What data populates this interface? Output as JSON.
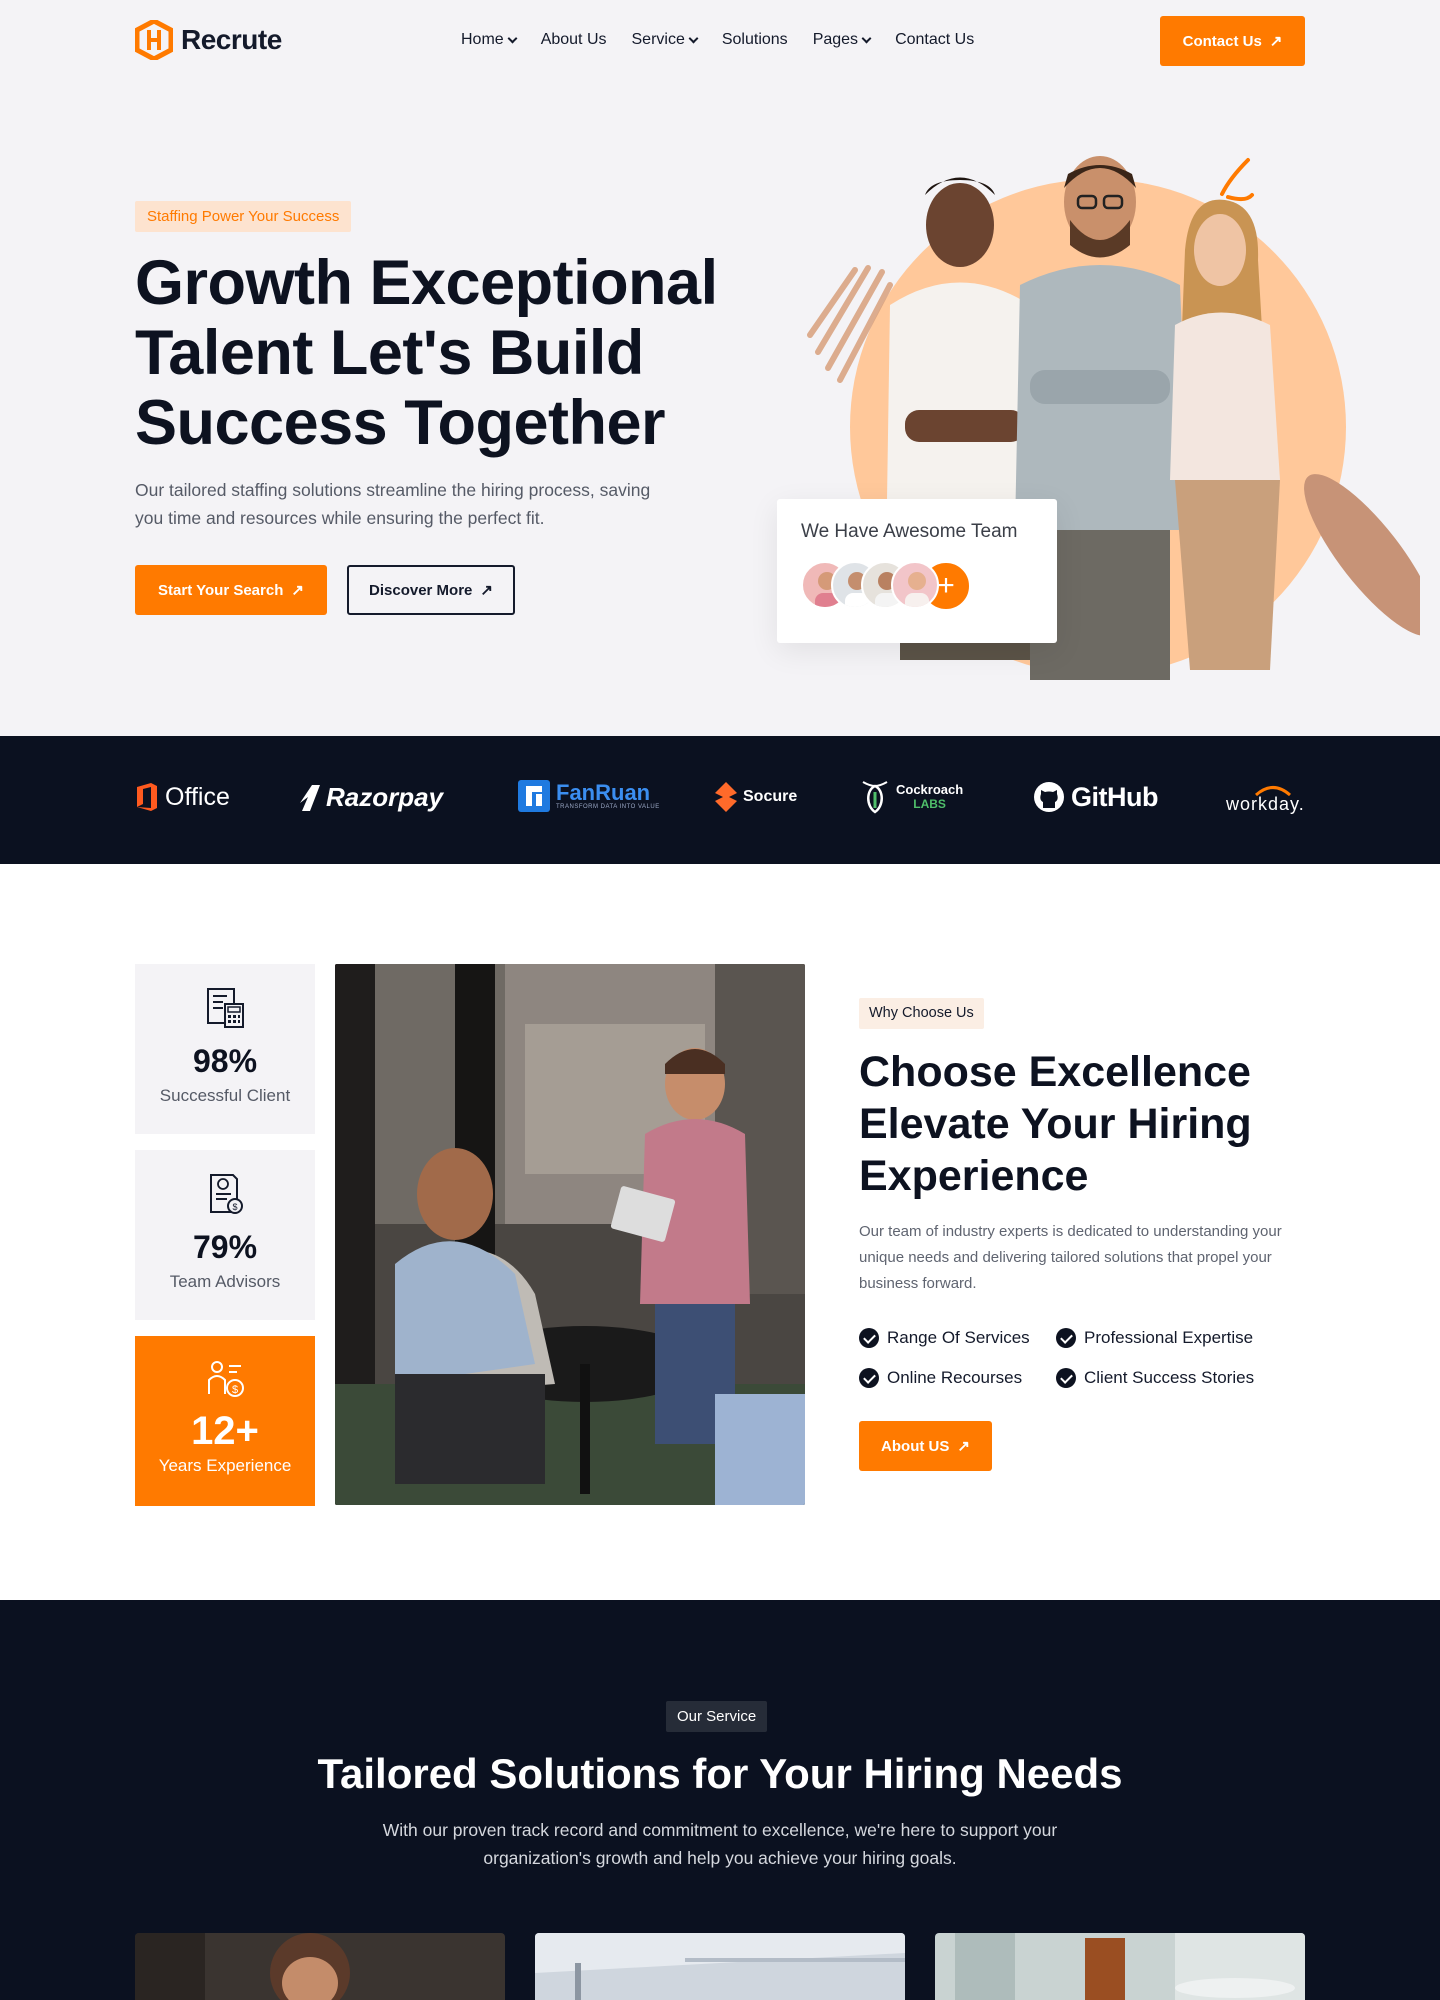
{
  "header": {
    "logo_text": "Recrute",
    "nav": [
      {
        "label": "Home",
        "dropdown": true
      },
      {
        "label": "About Us",
        "dropdown": false
      },
      {
        "label": "Service",
        "dropdown": true
      },
      {
        "label": "Solutions",
        "dropdown": false
      },
      {
        "label": "Pages",
        "dropdown": true
      },
      {
        "label": "Contact Us",
        "dropdown": false
      }
    ],
    "cta_label": "Contact Us"
  },
  "hero": {
    "tag": "Staffing Power Your Success",
    "title": "Growth Exceptional Talent Let's Build Success Together",
    "description": "Our tailored staffing solutions streamline the hiring process, saving you time and resources while ensuring the perfect fit.",
    "primary_button": "Start Your Search",
    "secondary_button": "Discover More",
    "team_card_title": "We Have Awesome Team",
    "team_card_plus": "+"
  },
  "brands": {
    "office": "Office",
    "razorpay": "Razorpay",
    "fanruan": "FanRuan",
    "fanruan_tagline": "TRANSFORM DATA INTO VALUE",
    "socure": "Socure",
    "cockroach_1": "Cockroach",
    "cockroach_2": "LABS",
    "github": "GitHub",
    "workday": "workday."
  },
  "why": {
    "stats": [
      {
        "value": "98%",
        "label": "Successful Client"
      },
      {
        "value": "79%",
        "label": "Team Advisors"
      },
      {
        "value": "12+",
        "label": "Years Experience"
      }
    ],
    "tag": "Why Choose Us",
    "title": "Choose Excellence Elevate Your Hiring Experience",
    "description": "Our team of industry experts is dedicated to understanding your unique needs and delivering tailored solutions that propel your business forward.",
    "features": [
      "Range Of Services",
      "Professional Expertise",
      "Online Recourses",
      "Client Success Stories"
    ],
    "button": "About US"
  },
  "services": {
    "tag": "Our Service",
    "title": "Tailored Solutions for Your Hiring Needs",
    "description": "With our proven track record and commitment to excellence, we're here to support your organization's growth and help you achieve your hiring goals."
  },
  "colors": {
    "accent": "#ff7a00",
    "dark": "#0b1120",
    "peach": "#ffc89a"
  }
}
